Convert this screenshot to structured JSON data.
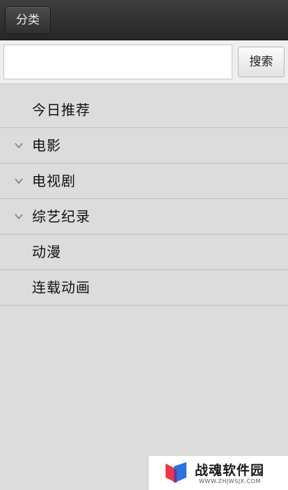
{
  "header": {
    "category_button_label": "分类"
  },
  "search": {
    "value": "",
    "placeholder": "",
    "button_label": "搜索"
  },
  "categories": [
    {
      "label": "今日推荐",
      "expandable": false
    },
    {
      "label": "电影",
      "expandable": true
    },
    {
      "label": "电视剧",
      "expandable": true
    },
    {
      "label": "综艺纪录",
      "expandable": true
    },
    {
      "label": "动漫",
      "expandable": false
    },
    {
      "label": "连载动画",
      "expandable": false
    }
  ],
  "icons": {
    "expand": "chevron-down-icon",
    "watermark_logo": "zhanhun-logo-icon"
  },
  "watermark": {
    "title": "战魂软件园",
    "url": "WWW.ZHJWSJX.COM"
  },
  "colors": {
    "header_bg": "#2e2e2e",
    "page_bg": "#dcdcdc",
    "logo_red": "#e8394a",
    "logo_blue": "#2f6fe0"
  }
}
